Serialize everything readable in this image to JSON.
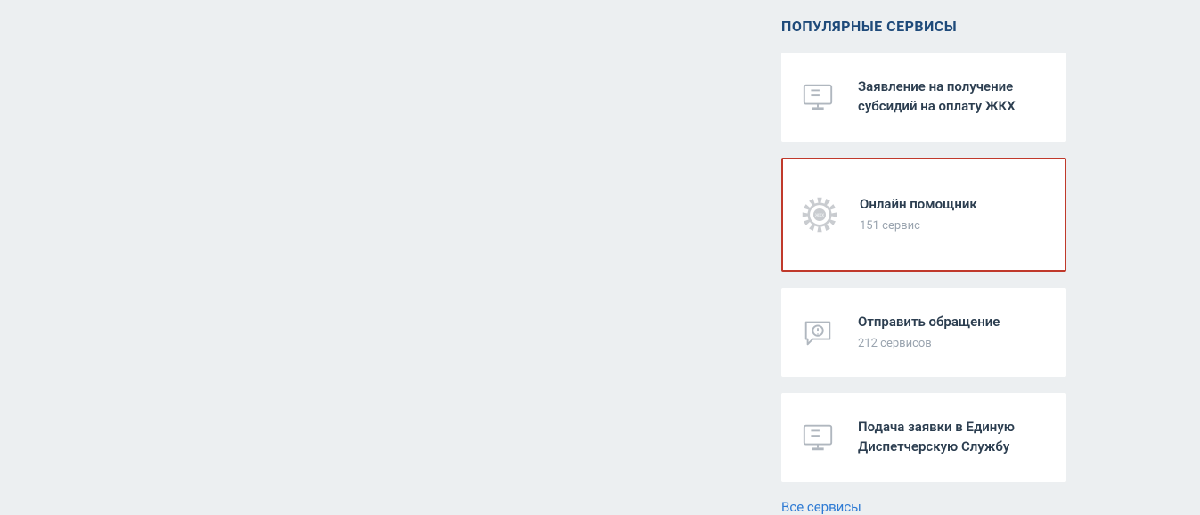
{
  "sidebar": {
    "title": "ПОПУЛЯРНЫЕ СЕРВИСЫ",
    "items": [
      {
        "title": "Заявление на получение субсидий на оплату ЖКХ",
        "subtitle": "",
        "icon": "monitor",
        "highlighted": false
      },
      {
        "title": "Онлайн помощник",
        "subtitle": "151 сервис",
        "icon": "gear",
        "highlighted": true
      },
      {
        "title": "Отправить обращение",
        "subtitle": "212 сервисов",
        "icon": "message-alert",
        "highlighted": false
      },
      {
        "title": "Подача заявки в Единую Диспетчерскую Службу",
        "subtitle": "",
        "icon": "monitor",
        "highlighted": false
      }
    ],
    "all_link": "Все сервисы"
  }
}
